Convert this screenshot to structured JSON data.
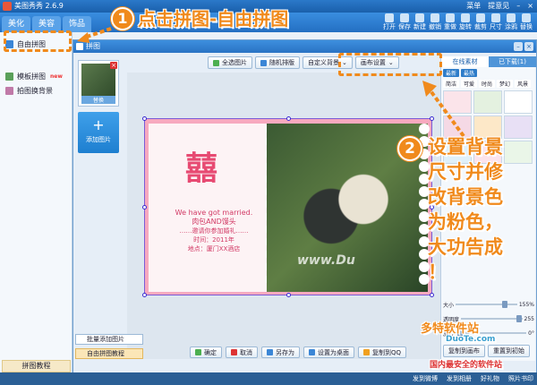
{
  "app": {
    "title": "美图秀秀 2.6.9",
    "menu": "菜单",
    "feedback": "提意见"
  },
  "tabs": [
    "美化",
    "美容",
    "饰品"
  ],
  "toolbar": [
    {
      "label": "打开"
    },
    {
      "label": "保存"
    },
    {
      "label": "新建"
    },
    {
      "label": "撤销"
    },
    {
      "label": "重做"
    },
    {
      "label": "旋转"
    },
    {
      "label": "裁剪"
    },
    {
      "label": "尺寸"
    },
    {
      "label": "涂鸦"
    },
    {
      "label": "替换"
    }
  ],
  "sidebar": {
    "items": [
      {
        "label": "自由拼图"
      },
      {
        "label": "模板拼图",
        "badge": "new"
      },
      {
        "label": "拍图换背景"
      }
    ],
    "footer": "拼图教程"
  },
  "collage": {
    "window_title": "拼图",
    "thumb_label": "替换",
    "add_image": "添加图片",
    "buttons": {
      "select_all": "全选图片",
      "random": "随机排版",
      "custom_bg": "自定义背景",
      "canvas_settings": "画布设置"
    },
    "batch_add": "批量添加图片",
    "free_collage": "自由拼图教程",
    "ok": "确定",
    "cancel": "取消",
    "save_as": "另存为",
    "set_desktop": "设置为桌面",
    "share": "复制到QQ"
  },
  "canvas": {
    "invite_line1": "We have got married.",
    "invite_line2": "肉包AND馒头",
    "invite_line3": "……邀请你参加婚礼……",
    "invite_line4": "时间：2011年",
    "invite_line5": "地点：厦门XX酒店",
    "watermark": "www.Du"
  },
  "right_panel": {
    "tabs": [
      "在线素材",
      "已下载(1)"
    ],
    "subtabs": [
      "最新",
      "最热"
    ],
    "cats": [
      "简洁",
      "可爱",
      "时尚",
      "梦幻",
      "风景"
    ],
    "sliders": [
      {
        "label": "大小",
        "value": "155%",
        "fraction": 0.76
      },
      {
        "label": "透明度",
        "value": "255",
        "fraction": 0.9
      },
      {
        "label": "旋转",
        "value": "0°",
        "fraction": 0.02
      }
    ],
    "copy_to_canvas": "复制到画布",
    "reset": "重置到初始"
  },
  "annotations": {
    "step1_badge": "1",
    "step1_text": "点击拼图-自由拼图",
    "step2_badge": "2",
    "step2_text": [
      "设置背景",
      "尺寸并修",
      "改背景色",
      "为粉色，",
      "大功告成",
      "！"
    ]
  },
  "statusbar": {
    "items": [
      "发到微博",
      "发到相册",
      "好礼物",
      "照片书印"
    ],
    "site_watermark": "多特软件站",
    "site_sub": "DuoTe.com",
    "site_slogan": "国内最安全的软件站"
  },
  "colors": {
    "accent_orange": "#f08a1c",
    "canvas_pink": "#f7a9bf",
    "title_blue": "#2b79c9"
  }
}
